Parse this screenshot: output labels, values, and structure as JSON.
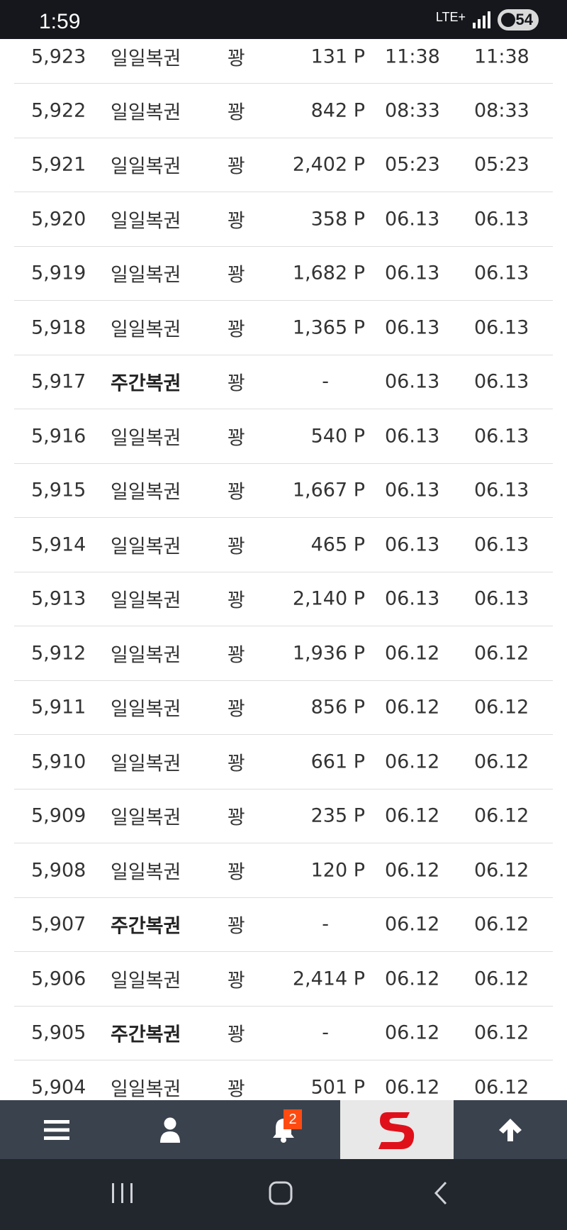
{
  "status_bar": {
    "time": "1:59",
    "network": "LTE+",
    "battery": "54"
  },
  "rows": [
    {
      "num": "5,923",
      "type": "일일복권",
      "bold": false,
      "result": "꽝",
      "points": "131 P",
      "date1": "11:38",
      "date2": "11:38"
    },
    {
      "num": "5,922",
      "type": "일일복권",
      "bold": false,
      "result": "꽝",
      "points": "842 P",
      "date1": "08:33",
      "date2": "08:33"
    },
    {
      "num": "5,921",
      "type": "일일복권",
      "bold": false,
      "result": "꽝",
      "points": "2,402 P",
      "date1": "05:23",
      "date2": "05:23"
    },
    {
      "num": "5,920",
      "type": "일일복권",
      "bold": false,
      "result": "꽝",
      "points": "358 P",
      "date1": "06.13",
      "date2": "06.13"
    },
    {
      "num": "5,919",
      "type": "일일복권",
      "bold": false,
      "result": "꽝",
      "points": "1,682 P",
      "date1": "06.13",
      "date2": "06.13"
    },
    {
      "num": "5,918",
      "type": "일일복권",
      "bold": false,
      "result": "꽝",
      "points": "1,365 P",
      "date1": "06.13",
      "date2": "06.13"
    },
    {
      "num": "5,917",
      "type": "주간복권",
      "bold": true,
      "result": "꽝",
      "points": "-",
      "date1": "06.13",
      "date2": "06.13"
    },
    {
      "num": "5,916",
      "type": "일일복권",
      "bold": false,
      "result": "꽝",
      "points": "540 P",
      "date1": "06.13",
      "date2": "06.13"
    },
    {
      "num": "5,915",
      "type": "일일복권",
      "bold": false,
      "result": "꽝",
      "points": "1,667 P",
      "date1": "06.13",
      "date2": "06.13"
    },
    {
      "num": "5,914",
      "type": "일일복권",
      "bold": false,
      "result": "꽝",
      "points": "465 P",
      "date1": "06.13",
      "date2": "06.13"
    },
    {
      "num": "5,913",
      "type": "일일복권",
      "bold": false,
      "result": "꽝",
      "points": "2,140 P",
      "date1": "06.13",
      "date2": "06.13"
    },
    {
      "num": "5,912",
      "type": "일일복권",
      "bold": false,
      "result": "꽝",
      "points": "1,936 P",
      "date1": "06.12",
      "date2": "06.12"
    },
    {
      "num": "5,911",
      "type": "일일복권",
      "bold": false,
      "result": "꽝",
      "points": "856 P",
      "date1": "06.12",
      "date2": "06.12"
    },
    {
      "num": "5,910",
      "type": "일일복권",
      "bold": false,
      "result": "꽝",
      "points": "661 P",
      "date1": "06.12",
      "date2": "06.12"
    },
    {
      "num": "5,909",
      "type": "일일복권",
      "bold": false,
      "result": "꽝",
      "points": "235 P",
      "date1": "06.12",
      "date2": "06.12"
    },
    {
      "num": "5,908",
      "type": "일일복권",
      "bold": false,
      "result": "꽝",
      "points": "120 P",
      "date1": "06.12",
      "date2": "06.12"
    },
    {
      "num": "5,907",
      "type": "주간복권",
      "bold": true,
      "result": "꽝",
      "points": "-",
      "date1": "06.12",
      "date2": "06.12"
    },
    {
      "num": "5,906",
      "type": "일일복권",
      "bold": false,
      "result": "꽝",
      "points": "2,414 P",
      "date1": "06.12",
      "date2": "06.12"
    },
    {
      "num": "5,905",
      "type": "주간복권",
      "bold": true,
      "result": "꽝",
      "points": "-",
      "date1": "06.12",
      "date2": "06.12"
    },
    {
      "num": "5,904",
      "type": "일일복권",
      "bold": false,
      "result": "꽝",
      "points": "501 P",
      "date1": "06.12",
      "date2": "06.12"
    }
  ],
  "bottom_nav": {
    "items": [
      {
        "icon": "menu-icon"
      },
      {
        "icon": "user-icon"
      },
      {
        "icon": "bell-icon",
        "badge": "2"
      },
      {
        "icon": "site-logo"
      },
      {
        "icon": "arrow-up-icon"
      }
    ]
  },
  "colors": {
    "status_bar": "#15171c",
    "nav_bar": "#3a424d",
    "badge": "#ff4b11",
    "logo_red": "#e0101a",
    "system_nav": "#22262d"
  }
}
